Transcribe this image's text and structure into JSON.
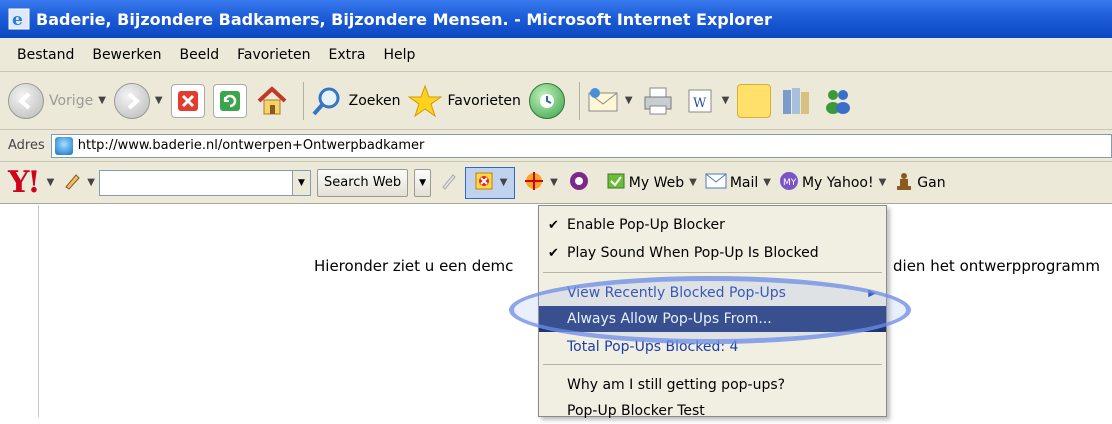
{
  "window": {
    "title": "Baderie, Bijzondere Badkamers, Bijzondere Mensen. - Microsoft Internet Explorer"
  },
  "menubar": {
    "items": [
      "Bestand",
      "Bewerken",
      "Beeld",
      "Favorieten",
      "Extra",
      "Help"
    ]
  },
  "toolbar": {
    "back_label": "Vorige",
    "search_label": "Zoeken",
    "favorites_label": "Favorieten"
  },
  "address": {
    "label": "Adres",
    "url": "http://www.baderie.nl/ontwerpen+Ontwerpbadkamer"
  },
  "yahoo_toolbar": {
    "logo": "Y!",
    "search_value": "",
    "search_button": "Search Web",
    "my_web": "My Web",
    "mail": "Mail",
    "my_yahoo": "My Yahoo!",
    "games": "Gan"
  },
  "page": {
    "text_left": "Hieronder ziet u een demc",
    "text_right": "dien het ontwerpprogramm"
  },
  "popup_menu": {
    "items": [
      {
        "label": "Enable Pop-Up Blocker",
        "checked": true
      },
      {
        "label": "Play Sound When Pop-Up Is Blocked",
        "checked": true
      },
      {
        "label": "View Recently Blocked Pop-Ups",
        "submenu": true
      },
      {
        "label": "Always Allow Pop-Ups From...",
        "selected": true
      },
      {
        "label": "Total Pop-Ups Blocked: 4"
      },
      {
        "label": "Why am I still getting pop-ups?"
      },
      {
        "label": "Pop-Up Blocker Test"
      }
    ]
  },
  "colors": {
    "titlebar": "#0a47c4",
    "chrome": "#ece9d8",
    "menu_selection": "#1c3474",
    "highlight_ellipse": "#6e8ce6",
    "yahoo_red": "#d0021b"
  }
}
